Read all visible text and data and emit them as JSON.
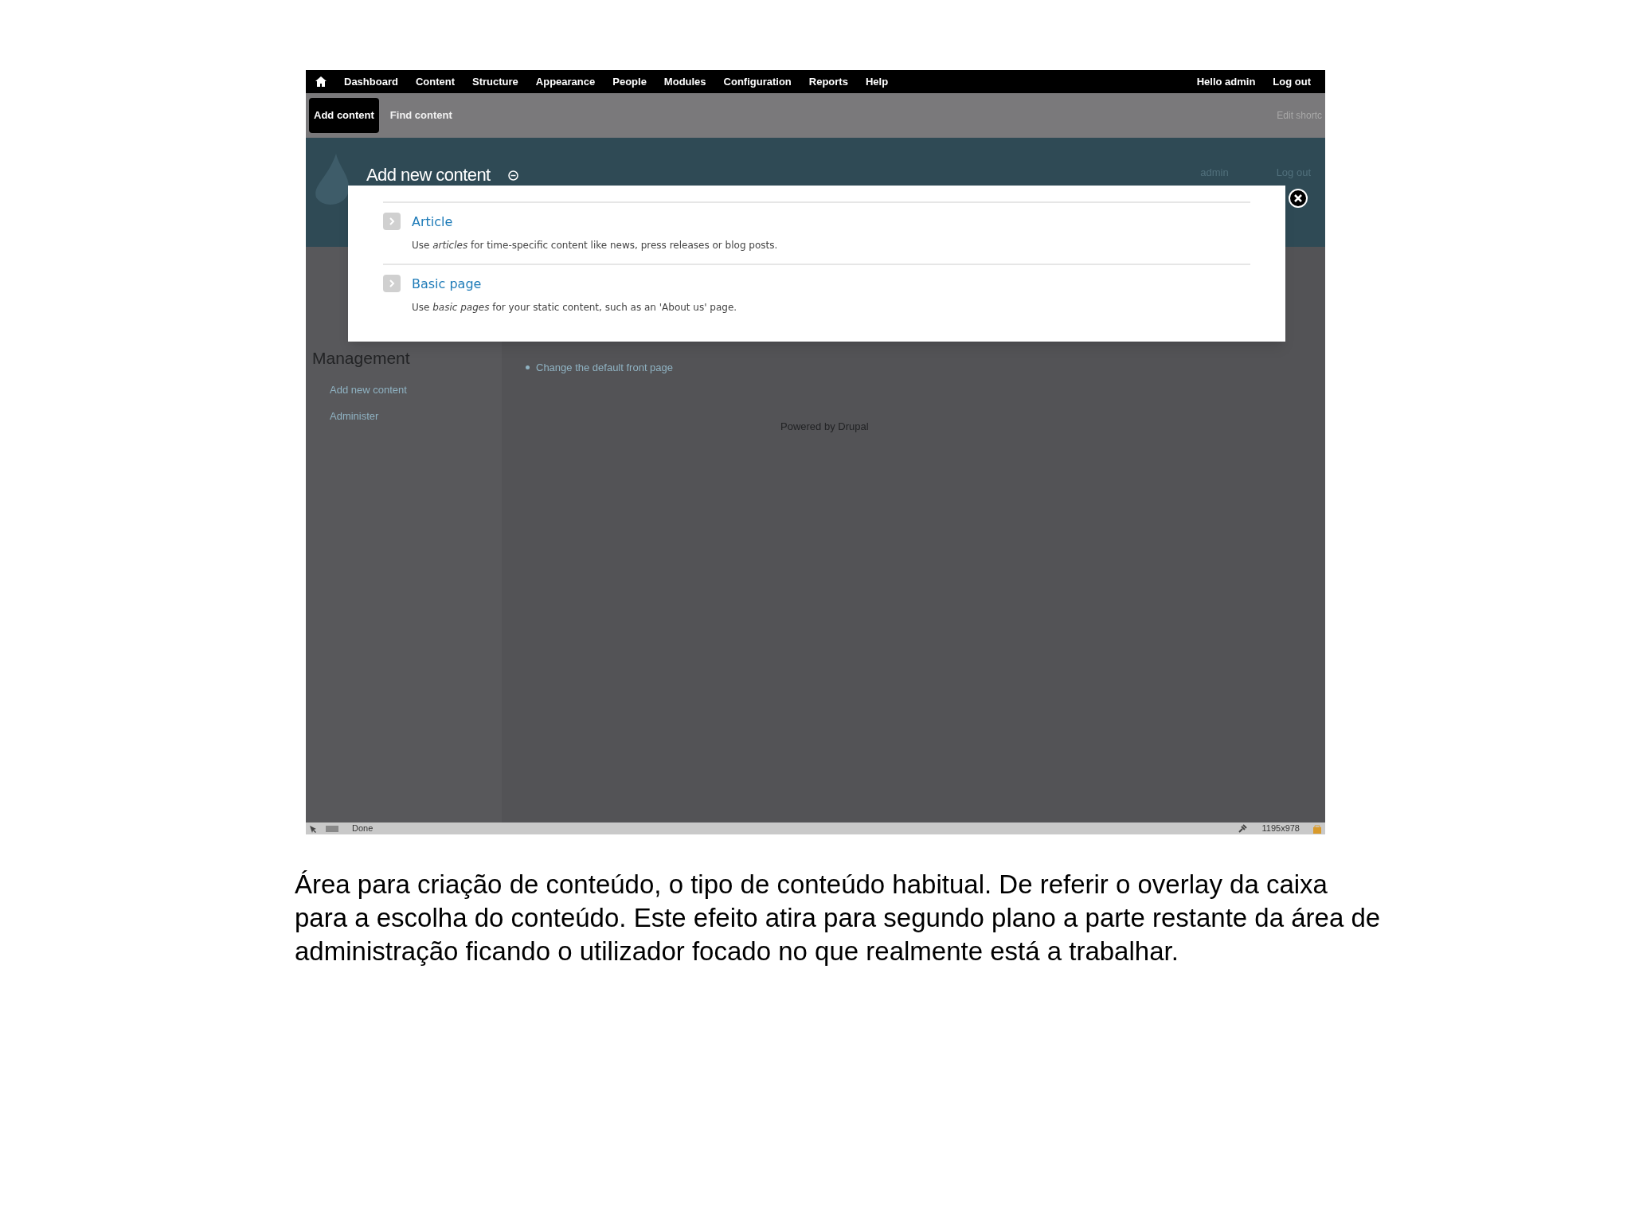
{
  "toolbar": {
    "menu": [
      {
        "label": "Dashboard"
      },
      {
        "label": "Content"
      },
      {
        "label": "Structure"
      },
      {
        "label": "Appearance"
      },
      {
        "label": "People"
      },
      {
        "label": "Modules"
      },
      {
        "label": "Configuration"
      },
      {
        "label": "Reports"
      },
      {
        "label": "Help"
      }
    ],
    "greeting": "Hello admin",
    "logout": "Log out"
  },
  "shortcuts": {
    "items": [
      {
        "label": "Add content",
        "selected": true
      },
      {
        "label": "Find content",
        "selected": false
      }
    ],
    "edit_link": "Edit shortc"
  },
  "page_header": {
    "title": "Add new content",
    "links": [
      "admin",
      "Log out"
    ]
  },
  "dialog": {
    "items": [
      {
        "title": "Article",
        "description": "Use *articles* for time-specific content like news, press releases or blog posts."
      },
      {
        "title": "Basic page",
        "description": "Use *basic pages* for your static content, such as an 'About us' page."
      }
    ]
  },
  "background": {
    "sidebar_heading": "Management",
    "sidebar_links": [
      "Add new content",
      "Administer"
    ],
    "content_links": [
      "Change the default front page"
    ],
    "footer": "Powered by Drupal"
  },
  "status_bar": {
    "status": "Done",
    "size": "1195x978"
  },
  "caption": "Área para criação de conteúdo, o tipo de conteúdo habitual. De referir o overlay da caixa para a escolha do conteúdo. Este efeito atira para segundo plano a parte restante da área de administração ficando o utilizador focado no que realmente está a trabalhar."
}
